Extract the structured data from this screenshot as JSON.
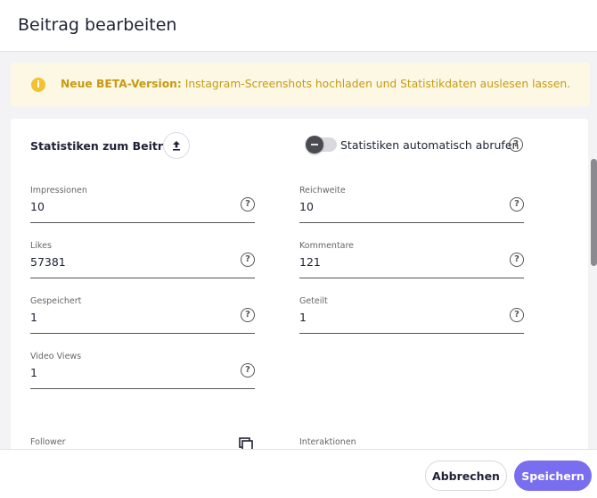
{
  "header": {
    "title": "Beitrag bearbeiten"
  },
  "banner": {
    "icon": "info-icon",
    "bold_text": "Neue BETA-Version:",
    "text": " Instagram-Screenshots hochladen und Statistikdaten auslesen lassen.",
    "accent_color": "#c79a12"
  },
  "stats": {
    "title": "Statistiken zum Beitrag",
    "upload_icon": "upload-icon",
    "toggle_label": "Statistiken automatisch abrufen",
    "toggle_on": false,
    "fields": {
      "impressionen": {
        "label": "Impressionen",
        "value": "10"
      },
      "reichweite": {
        "label": "Reichweite",
        "value": "10"
      },
      "likes": {
        "label": "Likes",
        "value": "57381"
      },
      "kommentare": {
        "label": "Kommentare",
        "value": "121"
      },
      "gespeichert": {
        "label": "Gespeichert",
        "value": "1"
      },
      "geteilt": {
        "label": "Geteilt",
        "value": "1"
      },
      "video_views": {
        "label": "Video Views",
        "value": "1"
      },
      "follower": {
        "label": "Follower",
        "value": ""
      },
      "interaktionen": {
        "label": "Interaktionen",
        "value": ""
      }
    }
  },
  "footer": {
    "cancel_label": "Abbrechen",
    "save_label": "Speichern",
    "save_color": "#7a6ef0"
  }
}
